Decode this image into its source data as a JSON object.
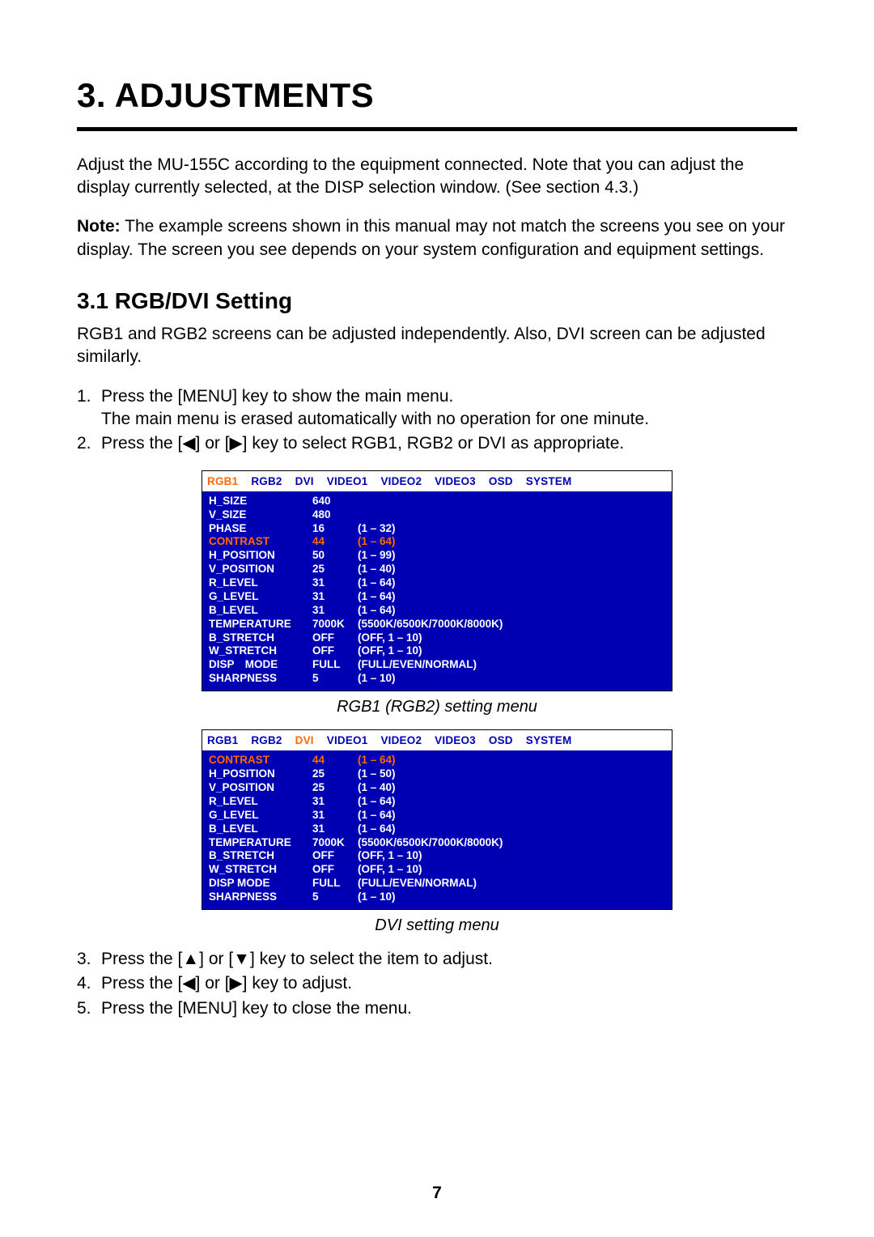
{
  "chapter_title": "3. ADJUSTMENTS",
  "intro_para": "Adjust the MU-155C according to the equipment connected. Note that you can adjust the display currently selected, at the DISP selection window. (See section 4.3.)",
  "note_label": "Note:",
  "note_text": " The example screens shown in this manual may not match the screens you see on your display. The screen you see depends on your system configuration and equipment settings.",
  "section_title": "3.1 RGB/DVI Setting",
  "section_para": "RGB1 and RGB2 screens can be adjusted independently. Also, DVI screen can be adjusted similarly.",
  "steps_a": [
    {
      "n": "1.",
      "t": "Press the [MENU] key to show the main menu.\nThe main menu is erased automatically with no operation for one minute."
    },
    {
      "n": "2.",
      "t": "Press the [◀] or [▶] key to select RGB1, RGB2 or DVI as appropriate."
    }
  ],
  "menu_tabs": [
    "RGB1",
    "RGB2",
    "DVI",
    "VIDEO1",
    "VIDEO2",
    "VIDEO3",
    "OSD",
    "SYSTEM"
  ],
  "rgb_menu": {
    "selected_tab": "RGB1",
    "rows": [
      {
        "label": "H_SIZE",
        "val": "640",
        "range": ""
      },
      {
        "label": "V_SIZE",
        "val": "480",
        "range": ""
      },
      {
        "label": "PHASE",
        "val": "16",
        "range": "(1 – 32)"
      },
      {
        "label": "CONTRAST",
        "val": "44",
        "range": "(1 – 64)",
        "sel": true
      },
      {
        "label": "H_POSITION",
        "val": "50",
        "range": "(1 – 99)"
      },
      {
        "label": "V_POSITION",
        "val": "25",
        "range": "(1 – 40)"
      },
      {
        "label": "R_LEVEL",
        "val": "31",
        "range": "(1 – 64)"
      },
      {
        "label": "G_LEVEL",
        "val": "31",
        "range": "(1 – 64)"
      },
      {
        "label": "B_LEVEL",
        "val": "31",
        "range": "(1 – 64)"
      },
      {
        "label": "TEMPERATURE",
        "val": "7000K",
        "range": "(5500K/6500K/7000K/8000K)"
      },
      {
        "label": "B_STRETCH",
        "val": "OFF",
        "range": "(OFF, 1 – 10)"
      },
      {
        "label": "W_STRETCH",
        "val": "OFF",
        "range": "(OFF, 1 – 10)"
      },
      {
        "label": "DISP　MODE",
        "val": "FULL",
        "range": "(FULL/EVEN/NORMAL)"
      },
      {
        "label": "SHARPNESS",
        "val": "5",
        "range": "(1 – 10)"
      }
    ],
    "caption": "RGB1 (RGB2) setting menu"
  },
  "dvi_menu": {
    "selected_tab": "DVI",
    "rows": [
      {
        "label": "CONTRAST",
        "val": "44",
        "range": "(1 – 64)",
        "sel": true
      },
      {
        "label": "H_POSITION",
        "val": "25",
        "range": "(1 – 50)"
      },
      {
        "label": "V_POSITION",
        "val": "25",
        "range": "(1 – 40)"
      },
      {
        "label": "R_LEVEL",
        "val": "31",
        "range": "(1 – 64)"
      },
      {
        "label": "G_LEVEL",
        "val": "31",
        "range": "(1 – 64)"
      },
      {
        "label": "B_LEVEL",
        "val": "31",
        "range": "(1 – 64)"
      },
      {
        "label": "TEMPERATURE",
        "val": "7000K",
        "range": "(5500K/6500K/7000K/8000K)"
      },
      {
        "label": "B_STRETCH",
        "val": "OFF",
        "range": "(OFF, 1 – 10)"
      },
      {
        "label": "W_STRETCH",
        "val": "OFF",
        "range": "(OFF, 1 – 10)"
      },
      {
        "label": "DISP MODE",
        "val": "FULL",
        "range": "(FULL/EVEN/NORMAL)"
      },
      {
        "label": "SHARPNESS",
        "val": "5",
        "range": "(1 – 10)"
      }
    ],
    "caption": "DVI setting menu"
  },
  "steps_b": [
    {
      "n": "3.",
      "t": "Press the [▲] or [▼] key to select the item to adjust."
    },
    {
      "n": "4.",
      "t": "Press the [◀] or [▶] key to adjust."
    },
    {
      "n": "5.",
      "t": "Press the [MENU] key to close the menu."
    }
  ],
  "page_number": "7"
}
